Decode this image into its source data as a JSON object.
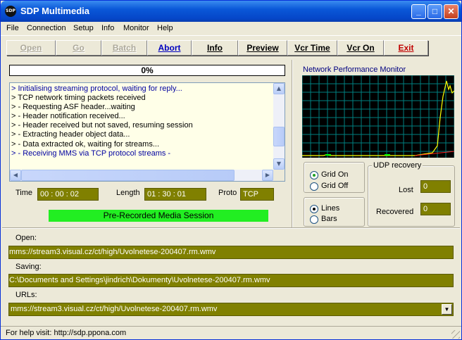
{
  "window": {
    "title": "SDP Multimedia",
    "icon_text": "SDP",
    "minimize_glyph": "_",
    "maximize_glyph": "□",
    "close_glyph": "✕"
  },
  "menu": [
    "File",
    "Connection",
    "Setup",
    "Info",
    "Monitor",
    "Help"
  ],
  "toolbar": {
    "open": "Open",
    "go": "Go",
    "batch": "Batch",
    "abort": "Abort",
    "info": "Info",
    "preview": "Preview",
    "vcr_time": "Vcr Time",
    "vcr_on": "Vcr On",
    "exit": "Exit"
  },
  "progress": {
    "label": "0%",
    "value": 0
  },
  "log": [
    "> Initialising streaming protocol, waiting for reply...",
    "> TCP network timing packets received",
    "> - Requesting ASF header...waiting",
    "> - Header notification received...",
    "> - Header received but not saved, resuming session",
    "> - Extracting header object data...",
    "> - Data extracted ok, waiting for streams...",
    "> - Receiving MMS via TCP protocol streams -"
  ],
  "stats": {
    "time_label": "Time",
    "time_value": "00 : 00 : 02",
    "length_label": "Length",
    "length_value": "01 : 30 : 01",
    "proto_label": "Proto",
    "proto_value": "TCP"
  },
  "session_banner": "Pre-Recorded Media Session",
  "monitor": {
    "title": "Network Performance Monitor",
    "grid_color": "#008080",
    "line_color": "#ffff00"
  },
  "grid_options": {
    "on": "Grid On",
    "off": "Grid Off",
    "selected": "Grid On"
  },
  "style_options": {
    "lines": "Lines",
    "bars": "Bars",
    "selected": "Lines"
  },
  "udp": {
    "title": "UDP recovery",
    "lost_label": "Lost",
    "lost_value": "0",
    "recovered_label": "Recovered",
    "recovered_value": "0"
  },
  "open": {
    "label": "Open:",
    "value": "mms://stream3.visual.cz/ct/high/Uvolnetese-200407.rm.wmv"
  },
  "saving": {
    "label": "Saving:",
    "value": "C:\\Documents and Settings\\jindrich\\Dokumenty\\Uvolnetese-200407.rm.wmv"
  },
  "urls": {
    "label": "URLs:",
    "value": "mms://stream3.visual.cz/ct/high/Uvolnetese-200407.rm.wmv"
  },
  "status": "For help visit: http://sdp.ppona.com",
  "colors": {
    "field_bg": "#808000",
    "session_bg": "#22ee22",
    "titlebar": "#0a58d8"
  }
}
